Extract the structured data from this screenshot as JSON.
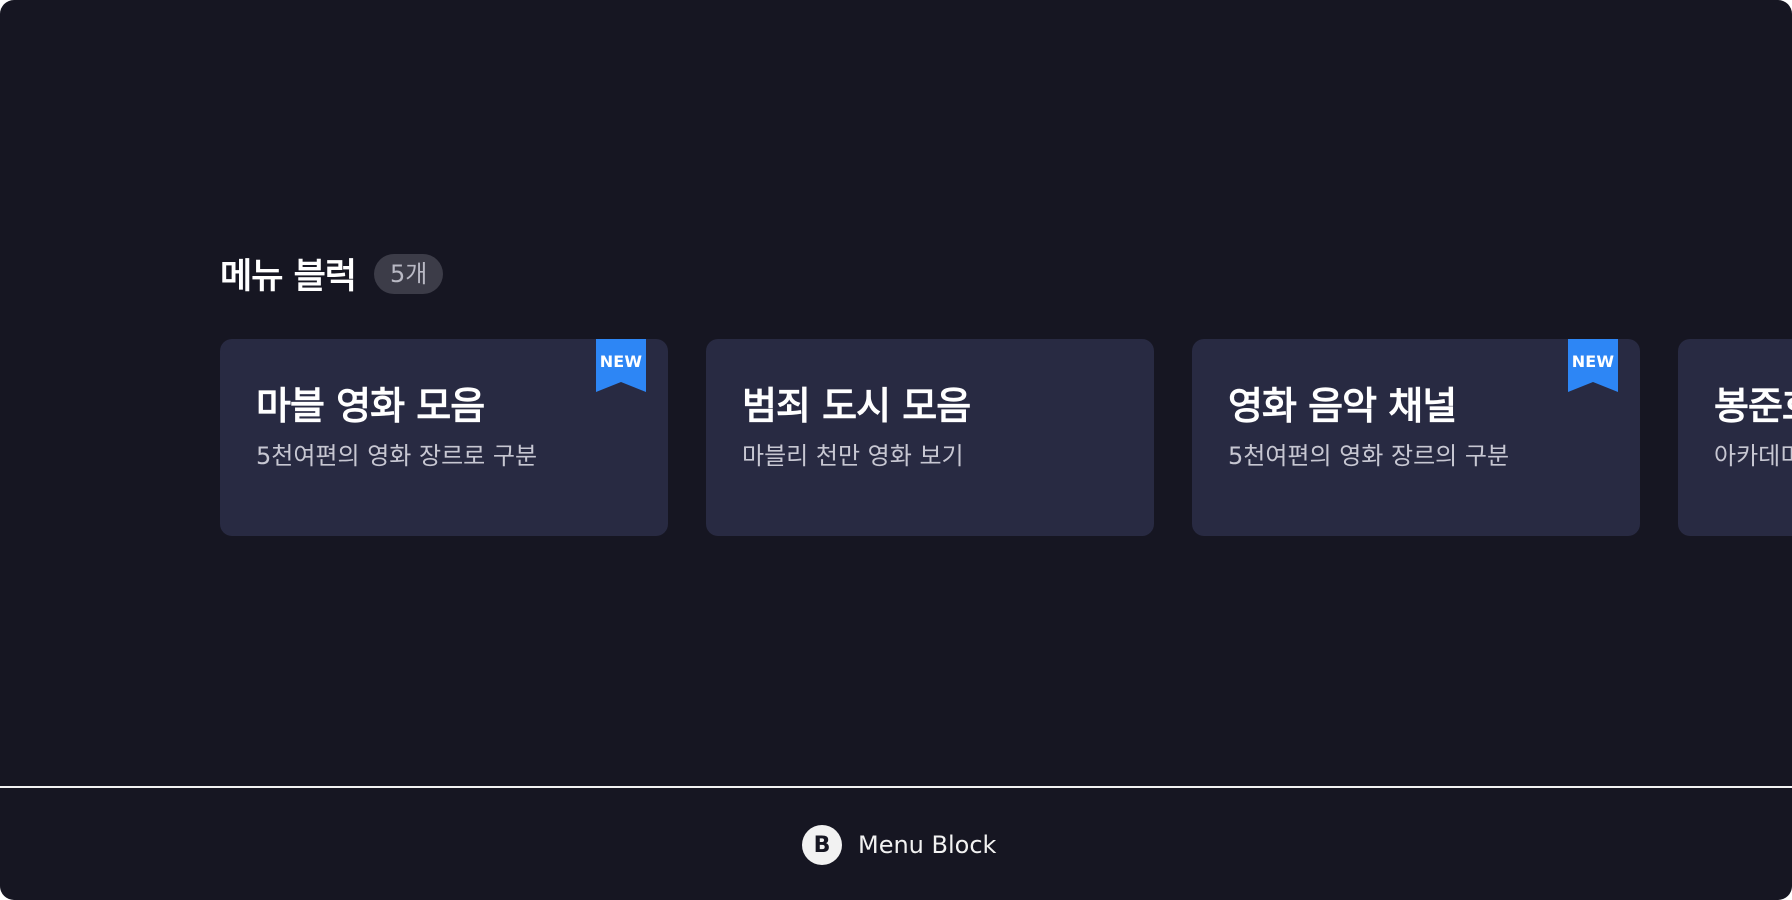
{
  "section": {
    "title": "메뉴 블럭",
    "count": "5개"
  },
  "cards": [
    {
      "title": "마블 영화 모음",
      "subtitle": "5천여편의 영화 장르로 구분",
      "new": true,
      "badge": "NEW"
    },
    {
      "title": "범죄 도시 모음",
      "subtitle": "마블리 천만 영화 보기",
      "new": false,
      "badge": ""
    },
    {
      "title": "영화 음악 채널",
      "subtitle": "5천여편의 영화 장르의 구분",
      "new": true,
      "badge": "NEW"
    },
    {
      "title": "봉준호",
      "subtitle": "아카데미",
      "new": false,
      "badge": ""
    }
  ],
  "footer": {
    "icon_letter": "B",
    "label": "Menu Block"
  },
  "colors": {
    "background": "#161622",
    "card": "#282a42",
    "badge": "#3c3c48",
    "ribbon": "#2d86f5",
    "divider": "#f2f2f2"
  }
}
